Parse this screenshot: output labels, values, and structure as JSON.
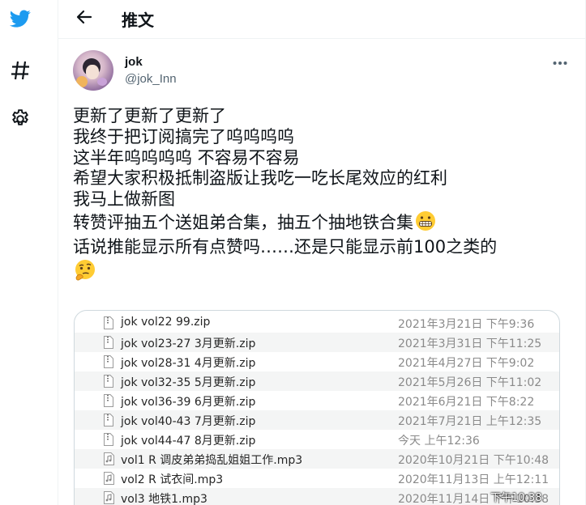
{
  "nav": {
    "items": [
      {
        "icon": "twitter-bird-icon",
        "color": "#1d9bf0"
      },
      {
        "icon": "hashtag-icon"
      },
      {
        "icon": "gear-icon"
      }
    ]
  },
  "header": {
    "back_icon": "arrow-left-icon",
    "title": "推文"
  },
  "tweet": {
    "author": {
      "display_name": "jok",
      "handle": "@jok_Inn"
    },
    "more_icon": "more-horizontal-icon",
    "lines": [
      "更新了更新了更新了",
      "我终于把订阅搞完了呜呜呜呜",
      "这半年呜呜呜呜  不容易不容易",
      "希望大家积极抵制盗版让我吃一吃长尾效应的红利",
      "我马上做新图",
      "转赞评抽五个送姐弟合集，抽五个抽地铁合集",
      "话说推能显示所有点赞吗……还是只能显示前100之类的"
    ],
    "emojis": [
      "grimacing-face",
      "thinking-face"
    ],
    "files": [
      {
        "name": "jok vol22 99.zip",
        "date": "2021年3月21日 下午9:36",
        "type": "zip"
      },
      {
        "name": "jok vol23-27 3月更新.zip",
        "date": "2021年3月31日 下午11:25",
        "type": "zip"
      },
      {
        "name": "jok vol28-31 4月更新.zip",
        "date": "2021年4月27日 下午9:02",
        "type": "zip"
      },
      {
        "name": "jok vol32-35 5月更新.zip",
        "date": "2021年5月26日 下午11:02",
        "type": "zip"
      },
      {
        "name": "jok vol36-39 6月更新.zip",
        "date": "2021年6月21日 下午8:22",
        "type": "zip"
      },
      {
        "name": "jok vol40-43 7月更新.zip",
        "date": "2021年7月21日 上午12:35",
        "type": "zip"
      },
      {
        "name": "jok vol44-47 8月更新.zip",
        "date": "今天 上午12:36",
        "type": "zip"
      },
      {
        "name": "vol1 R 调皮弟弟捣乱姐姐工作.mp3",
        "date": "2020年10月21日 下午10:48",
        "type": "mp3"
      },
      {
        "name": "vol2 R 试衣间.mp3",
        "date": "2020年11月13日 上午12:11",
        "type": "mp3"
      },
      {
        "name": "vol3 地铁1.mp3",
        "date": "2020年11月14日 下午10:38",
        "type": "mp3"
      }
    ]
  },
  "watermark": "下午10:38"
}
